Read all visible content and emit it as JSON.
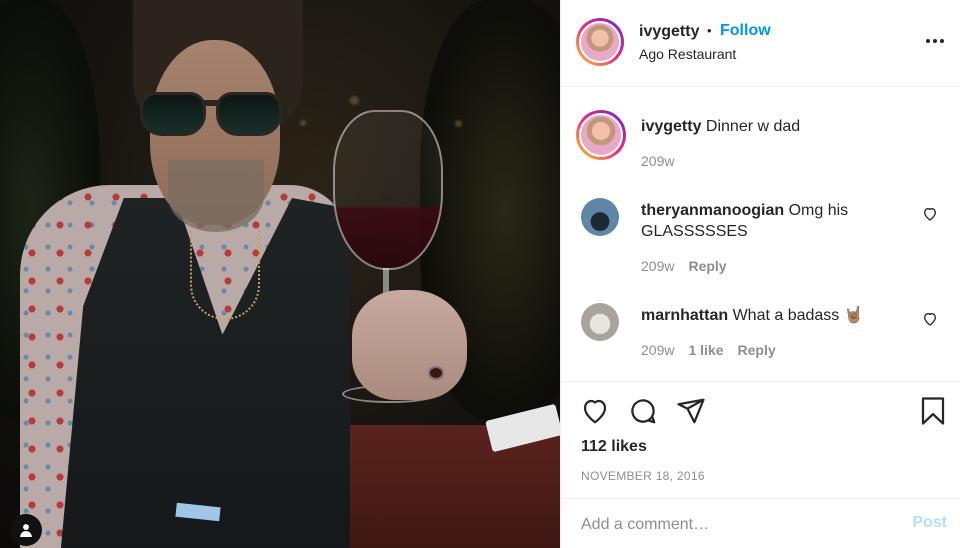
{
  "post": {
    "author": "ivygetty",
    "follow_label": "Follow",
    "dot": "•",
    "location": "Ago Restaurant",
    "more_icon": "more-options-icon"
  },
  "comments": [
    {
      "username": "ivygetty",
      "text": "Dinner w dad",
      "time": "209w"
    },
    {
      "username": "theryanmanoogian",
      "text": "Omg his GLASSSSSES",
      "time": "209w",
      "reply_label": "Reply"
    },
    {
      "username": "marnhattan",
      "text": "What a badass",
      "emoji": "🤘🏽",
      "time": "209w",
      "likes_label": "1 like",
      "reply_label": "Reply"
    }
  ],
  "actions": {
    "likes": "112 likes",
    "date": "NOVEMBER 18, 2016"
  },
  "add_comment": {
    "placeholder": "Add a comment…",
    "post_label": "Post"
  },
  "colors": {
    "link_blue": "#0095f6",
    "post_disabled": "#b2dffc",
    "secondary_text": "#8e8e8e",
    "divider": "#efefef"
  }
}
